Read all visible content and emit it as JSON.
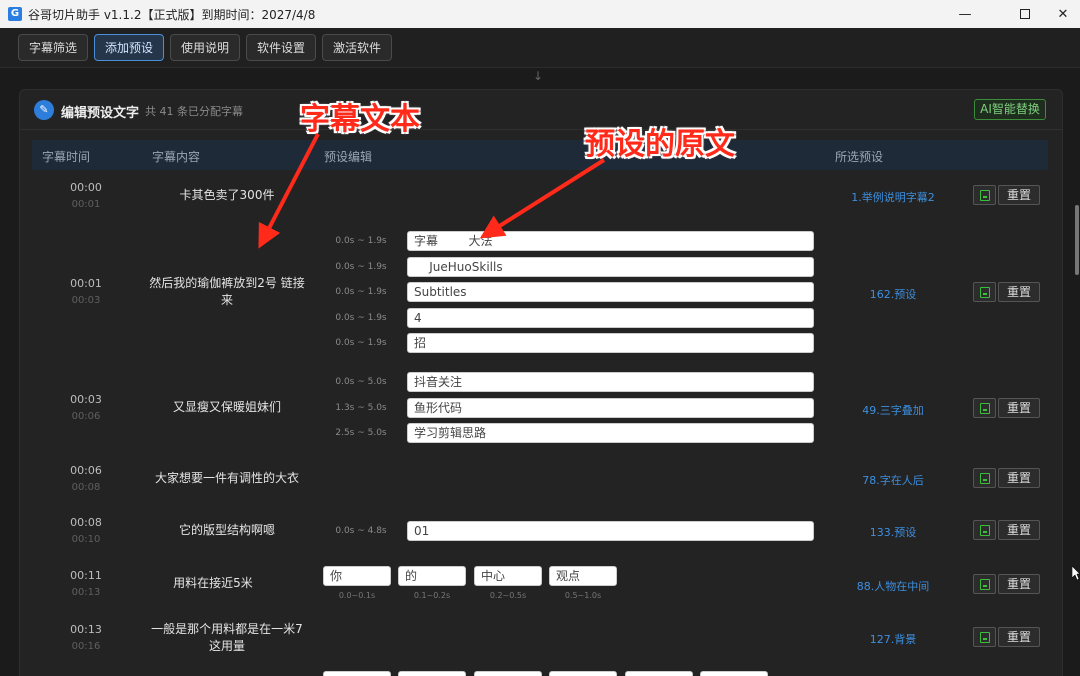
{
  "window": {
    "title": "谷哥切片助手 v1.1.2【正式版】到期时间：2027/4/8",
    "minimize": "—",
    "close": "✕"
  },
  "toolbar": {
    "subtitle_filter": "字幕筛选",
    "add_preset": "添加预设",
    "usage_guide": "使用说明",
    "software_settings": "软件设置",
    "activate_software": "激活软件"
  },
  "panel": {
    "title": "编辑预设文字",
    "subtitle": "共 41 条已分配字幕",
    "ai_button": "AI智能替换"
  },
  "table_headers": {
    "time": "字幕时间",
    "content": "字幕内容",
    "preset_edit": "预设编辑",
    "selected_preset": "所选预设"
  },
  "rows": [
    {
      "start": "00:00",
      "end": "00:01",
      "content": "卡其色卖了300件",
      "preset": "1.举例说明字幕2",
      "items": []
    },
    {
      "start": "00:01",
      "end": "00:03",
      "content": "然后我的瑜伽裤放到2号 链接来",
      "preset": "162.预设",
      "items": [
        {
          "range": "0.0s ~ 1.9s",
          "text": "字幕        大法"
        },
        {
          "range": "0.0s ~ 1.9s",
          "text": "    JueHuoSkills"
        },
        {
          "range": "0.0s ~ 1.9s",
          "text": "Subtitles"
        },
        {
          "range": "0.0s ~ 1.9s",
          "text": "4"
        },
        {
          "range": "0.0s ~ 1.9s",
          "text": "招"
        }
      ]
    },
    {
      "start": "00:03",
      "end": "00:06",
      "content": "又显瘦又保暖姐妹们",
      "preset": "49.三字叠加",
      "items": [
        {
          "range": "0.0s ~ 5.0s",
          "text": "抖音关注"
        },
        {
          "range": "1.3s ~ 5.0s",
          "text": "鱼形代码"
        },
        {
          "range": "2.5s ~ 5.0s",
          "text": "学习剪辑思路"
        }
      ]
    },
    {
      "start": "00:06",
      "end": "00:08",
      "content": "大家想要一件有调性的大衣",
      "preset": "78.字在人后",
      "items": []
    },
    {
      "start": "00:08",
      "end": "00:10",
      "content": "它的版型结构啊嗯",
      "preset": "133.预设",
      "items": [
        {
          "range": "0.0s ~ 4.8s",
          "text": "01"
        }
      ]
    },
    {
      "start": "00:11",
      "end": "00:13",
      "content": "用料在接近5米",
      "preset": "88.人物在中间",
      "chips": [
        {
          "text": "你",
          "range": "0.0~0.1s"
        },
        {
          "text": "的",
          "range": "0.1~0.2s"
        },
        {
          "text": "中心",
          "range": "0.2~0.5s"
        },
        {
          "text": "观点",
          "range": "0.5~1.0s"
        }
      ]
    },
    {
      "start": "00:13",
      "end": "00:16",
      "content": "一般是那个用料都是在一米7这用量",
      "preset": "127.背景",
      "items": []
    }
  ],
  "row_reset_label": "重置",
  "annotations": {
    "subtitle_text": "字幕文本",
    "preset_original": "预设的原文"
  },
  "colors": {
    "accent": "#3d8fe0",
    "annotation": "#ff2a1a",
    "ai_green": "#7fd07f"
  }
}
